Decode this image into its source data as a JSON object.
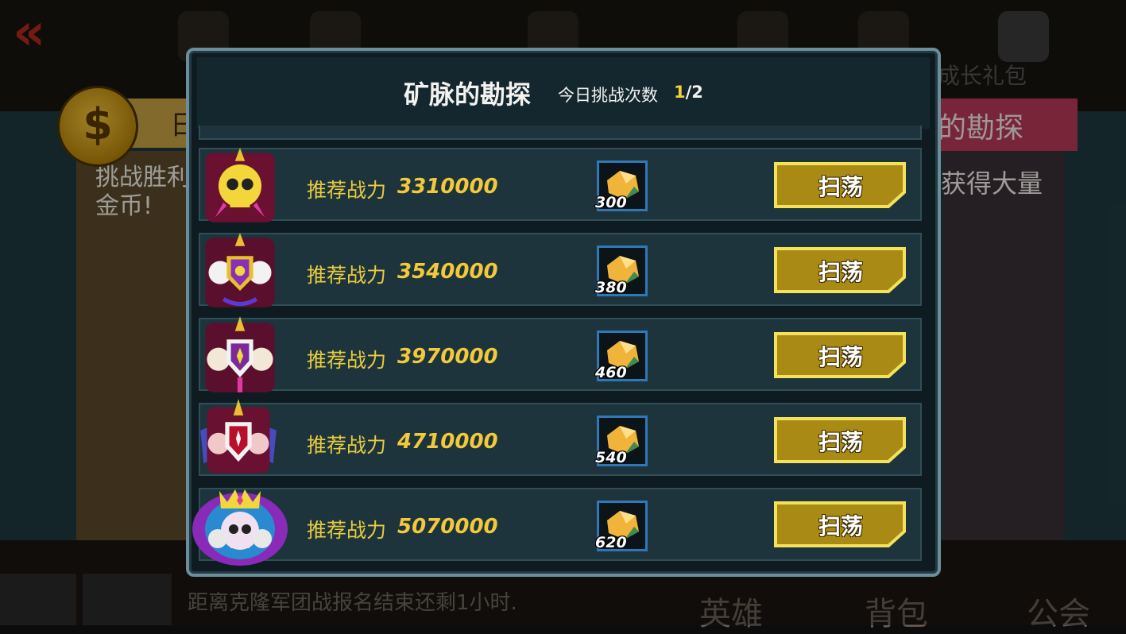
{
  "background": {
    "left_banner_text": "日",
    "left_description": "挑战胜利金币!",
    "right_banner_text": "的勘探",
    "right_description": "获得大量",
    "growth_pack_text": "成长礼包",
    "bottom_notice": "距离克隆军团战报名结束还剩1小时.",
    "nav": {
      "hero": "英雄",
      "bag": "背包",
      "guild": "公会"
    }
  },
  "dialog": {
    "title": "矿脉的勘探",
    "challenge_label": "今日挑战次数",
    "challenge_current": "1",
    "challenge_total": "/2"
  },
  "power_label": "推荐战力",
  "sweep_label": "扫荡",
  "stages": [
    {
      "emblem": "gold-skull-emblem-icon",
      "power": "3310000",
      "reward": "300"
    },
    {
      "emblem": "white-skull-shield-emblem-icon",
      "power": "3540000",
      "reward": "380"
    },
    {
      "emblem": "triple-skull-shield-emblem-icon",
      "power": "3970000",
      "reward": "460"
    },
    {
      "emblem": "winged-skull-shield-emblem-icon",
      "power": "4710000",
      "reward": "540"
    },
    {
      "emblem": "crowned-skull-emblem-icon",
      "power": "5070000",
      "reward": "620"
    }
  ],
  "colors": {
    "accent_gold": "#f1c93a",
    "reward_frame": "#2f78b8",
    "button_fill": "#a88a14",
    "button_border": "#f3e25a"
  }
}
